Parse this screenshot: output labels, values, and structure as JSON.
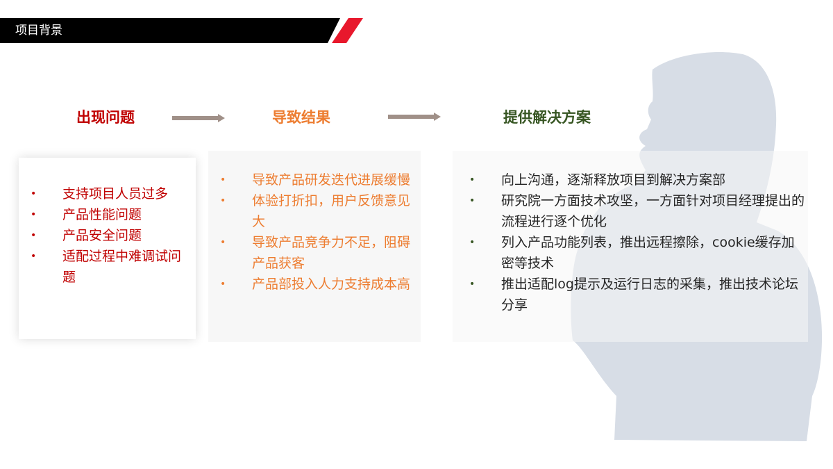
{
  "header": {
    "title": "项目背景"
  },
  "stages": {
    "problem": {
      "title": "出现问题",
      "items": [
        "支持项目人员过多",
        "产品性能问题",
        "产品安全问题",
        "适配过程中难调试问题"
      ]
    },
    "result": {
      "title": "导致结果",
      "items": [
        "导致产品研发迭代进展缓慢",
        "体验打折扣，用户反馈意见大",
        "导致产品竞争力不足，阻碍产品获客",
        "产品部投入人力支持成本高"
      ]
    },
    "solution": {
      "title": "提供解决方案",
      "items": [
        "向上沟通，逐渐释放项目到解决方案部",
        "研究院一方面技术攻坚，一方面针对项目经理提出的流程进行逐个优化",
        "列入产品功能列表，推出远程擦除，cookie缓存加密等技术",
        "推出适配log提示及运行日志的采集，推出技术论坛分享"
      ]
    }
  },
  "bullet_glyph": "•",
  "colors": {
    "header_bar": "#000000",
    "header_accent": "#e8182c",
    "problem": "#c00000",
    "result": "#ed7d31",
    "solution_title": "#375623",
    "solution_text": "#262626",
    "arrow": "#a09088",
    "silhouette": "#d7dde6"
  },
  "icons": [
    "arrow-right-icon",
    "person-silhouette-icon"
  ]
}
